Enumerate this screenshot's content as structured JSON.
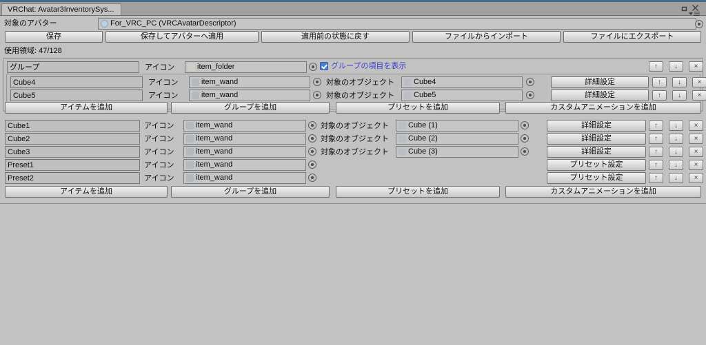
{
  "window": {
    "tab_title": "VRChat: Avatar3InventorySys...",
    "maximize_icon": "maximize-icon",
    "close_icon": "close-icon",
    "menu_icon": "panel-menu-icon"
  },
  "header": {
    "avatar_label": "対象のアバター",
    "avatar_value": "For_VRC_PC (VRCAvatarDescriptor)",
    "usage_label": "使用領域: 47/128",
    "buttons": [
      {
        "label": "保存"
      },
      {
        "label": "保存してアバターへ適用"
      },
      {
        "label": "適用前の状態に戻す"
      },
      {
        "label": "ファイルからインポート"
      },
      {
        "label": "ファイルにエクスポート"
      }
    ]
  },
  "labels": {
    "icon": "アイコン",
    "target_object": "対象のオブジェクト",
    "detail_settings": "詳細設定",
    "preset_settings": "プリセット設定",
    "move_up": "↑",
    "move_down": "↓",
    "remove": "×"
  },
  "group_panel": {
    "name_value": "グループ",
    "icon_label": "アイコン",
    "icon_value": "item_folder",
    "show_group_items_label": "グループの項目を表示",
    "show_group_items_checked": true,
    "children": [
      {
        "name": "Cube4",
        "icon_label": "アイコン",
        "icon_value": "item_wand",
        "target_label": "対象のオブジェクト",
        "target_value": "Cube4",
        "action_label": "詳細設定"
      },
      {
        "name": "Cube5",
        "icon_label": "アイコン",
        "icon_value": "item_wand",
        "target_label": "対象のオブジェクト",
        "target_value": "Cube5",
        "action_label": "詳細設定"
      }
    ],
    "add_buttons": [
      {
        "label": "アイテムを追加"
      },
      {
        "label": "グループを追加"
      },
      {
        "label": "プリセットを追加"
      },
      {
        "label": "カスタムアニメーションを追加"
      }
    ]
  },
  "root_panel": {
    "rows": [
      {
        "name": "Cube1",
        "icon_label": "アイコン",
        "icon_value": "item_wand",
        "target_label": "対象のオブジェクト",
        "target_value": "Cube (1)",
        "has_target": true,
        "action_label": "詳細設定"
      },
      {
        "name": "Cube2",
        "icon_label": "アイコン",
        "icon_value": "item_wand",
        "target_label": "対象のオブジェクト",
        "target_value": "Cube (2)",
        "has_target": true,
        "action_label": "詳細設定"
      },
      {
        "name": "Cube3",
        "icon_label": "アイコン",
        "icon_value": "item_wand",
        "target_label": "対象のオブジェクト",
        "target_value": "Cube (3)",
        "has_target": true,
        "action_label": "詳細設定"
      },
      {
        "name": "Preset1",
        "icon_label": "アイコン",
        "icon_value": "item_wand",
        "target_label": "",
        "target_value": "",
        "has_target": false,
        "action_label": "プリセット設定"
      },
      {
        "name": "Preset2",
        "icon_label": "アイコン",
        "icon_value": "item_wand",
        "target_label": "",
        "target_value": "",
        "has_target": false,
        "action_label": "プリセット設定"
      }
    ],
    "add_buttons": [
      {
        "label": "アイテムを追加"
      },
      {
        "label": "グループを追加"
      },
      {
        "label": "プリセットを追加"
      },
      {
        "label": "カスタムアニメーションを追加"
      }
    ]
  },
  "colors": {
    "window_bg": "#9b9b9b",
    "content_bg": "#c2c2c2",
    "accent_blue": "#4a7fd4",
    "link_blue": "#3a3ad0",
    "titlebar_line": "#4a6a8e"
  }
}
